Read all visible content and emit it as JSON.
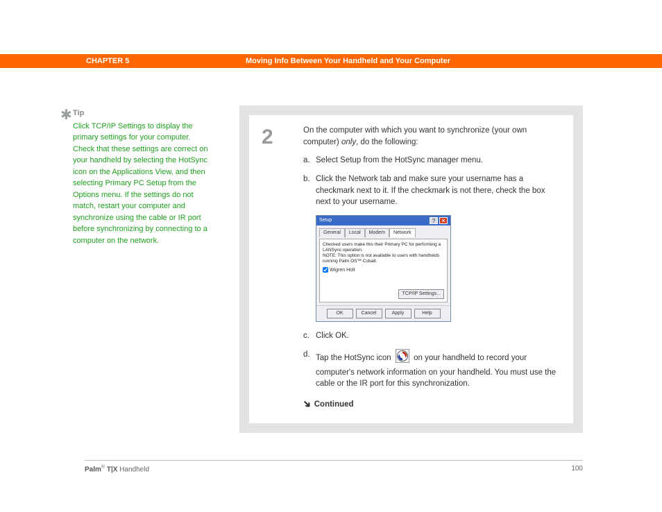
{
  "header": {
    "chapter": "CHAPTER 5",
    "title": "Moving Info Between Your Handheld and Your Computer"
  },
  "sidebar": {
    "star": "✱",
    "tip_label": "Tip",
    "tip_body": "Click TCP/IP Settings to display the primary settings for your computer. Check that these settings are correct on your handheld by selecting the HotSync icon on the Applications View, and then selecting Primary PC Setup from the Options menu. If the settings do not match, restart your computer and synchronize using the cable or IR port before synchronizing by connecting to a computer on the network."
  },
  "step": {
    "number": "2",
    "intro_a": "On the computer with which you want to synchronize (your own computer) ",
    "intro_only": "only",
    "intro_b": ", do the following:",
    "a_label": "a.",
    "a_text": "Select Setup from the HotSync manager menu.",
    "b_label": "b.",
    "b_text": "Click the Network tab and make sure your username has a checkmark next to it. If the checkmark is not there, check the box next to your username.",
    "c_label": "c.",
    "c_text": "Click OK.",
    "d_label": "d.",
    "d_text_a": "Tap the HotSync icon ",
    "d_text_b": " on your handheld to record your computer's network information on your handheld. You must use the cable or the IR port for this synchronization.",
    "continued": "Continued"
  },
  "dialog": {
    "title": "Setup",
    "tabs": {
      "general": "General",
      "local": "Local",
      "modem": "Modem",
      "network": "Network"
    },
    "note": "Checked users make this their Primary PC for performing a LANSync operation.\nNOTE: This option is not available to users with handhelds running Palm OS™ Cobalt.",
    "username": "Wigren Holt",
    "tcpip": "TCP/IP Settings...",
    "ok": "OK",
    "cancel": "Cancel",
    "apply": "Apply",
    "help": "Help"
  },
  "footer": {
    "brand_a": "Palm",
    "reg": "®",
    "brand_b": " T|X",
    "brand_c": " Handheld",
    "page": "100"
  }
}
